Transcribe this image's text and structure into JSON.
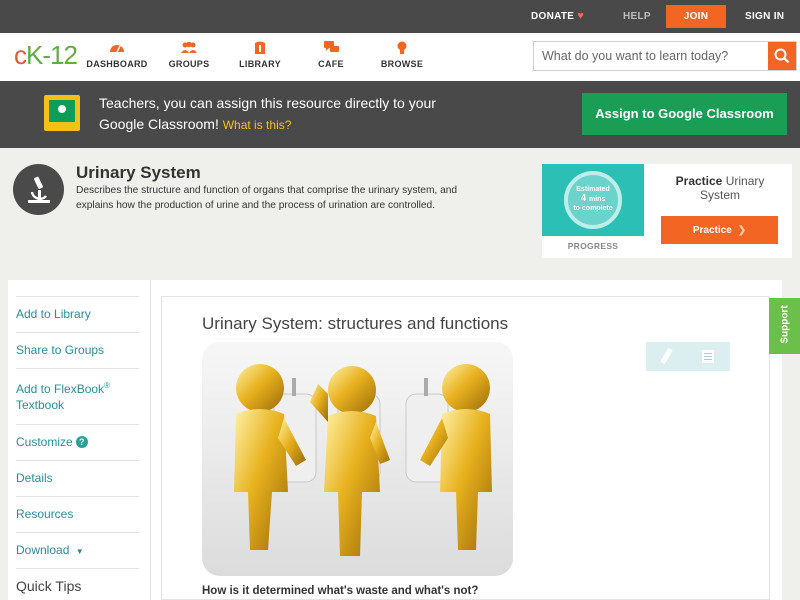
{
  "topbar": {
    "donate": "DONATE",
    "help": "HELP",
    "join": "JOIN",
    "signin": "SIGN IN"
  },
  "logo": {
    "c": "c",
    "k": "K",
    "rest": "-12"
  },
  "nav": {
    "items": [
      {
        "label": "DASHBOARD",
        "icon": "dashboard-icon"
      },
      {
        "label": "GROUPS",
        "icon": "groups-icon"
      },
      {
        "label": "LIBRARY",
        "icon": "library-icon"
      },
      {
        "label": "CAFE",
        "icon": "cafe-icon"
      },
      {
        "label": "BROWSE",
        "icon": "browse-icon"
      }
    ]
  },
  "search": {
    "placeholder": "What do you want to learn today?"
  },
  "classroom": {
    "text": "Teachers, you can assign this resource directly to your Google Classroom!",
    "what": "What is this?",
    "button": "Assign to Google Classroom"
  },
  "concept": {
    "title": "Urinary System",
    "description": "Describes the structure and function of organs that comprise the urinary system, and explains how the production of urine and the process of urination are controlled."
  },
  "practice": {
    "estimated": "Estimated",
    "minutes": "4",
    "mins": "mins",
    "to_complete": "to complete",
    "progress": "PROGRESS",
    "title_bold": "Practice",
    "title_rest": "Urinary System",
    "button": "Practice"
  },
  "sidebar": {
    "items": [
      {
        "label": "Add to Library"
      },
      {
        "label": "Share to Groups"
      },
      {
        "label": "Add to FlexBook",
        "sup": "®",
        "label2": "Textbook"
      },
      {
        "label": "Customize"
      },
      {
        "label": "Details"
      },
      {
        "label": "Resources"
      },
      {
        "label": "Download",
        "caret": "▼"
      }
    ],
    "quick_tips": "Quick Tips"
  },
  "article": {
    "title": "Urinary System: structures and functions",
    "question": "How is it determined what's waste and what's not?"
  },
  "support": "Support",
  "colors": {
    "accent": "#f26522",
    "teal": "#2a8d95",
    "green": "#1a9e56",
    "dark": "#494949"
  }
}
